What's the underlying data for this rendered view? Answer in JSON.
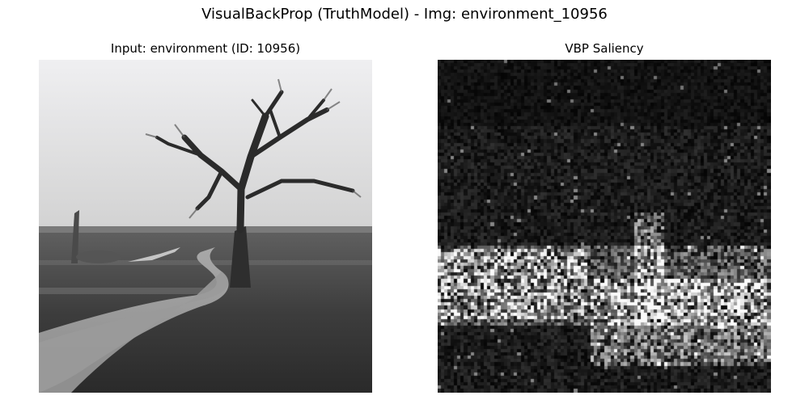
{
  "figure": {
    "title": "VisualBackProp (TruthModel) - Img: environment_10956"
  },
  "panels": {
    "input": {
      "title": "Input: environment (ID: 10956)",
      "colormap": "gray"
    },
    "saliency": {
      "title": "VBP Saliency",
      "colormap": "gray"
    }
  }
}
